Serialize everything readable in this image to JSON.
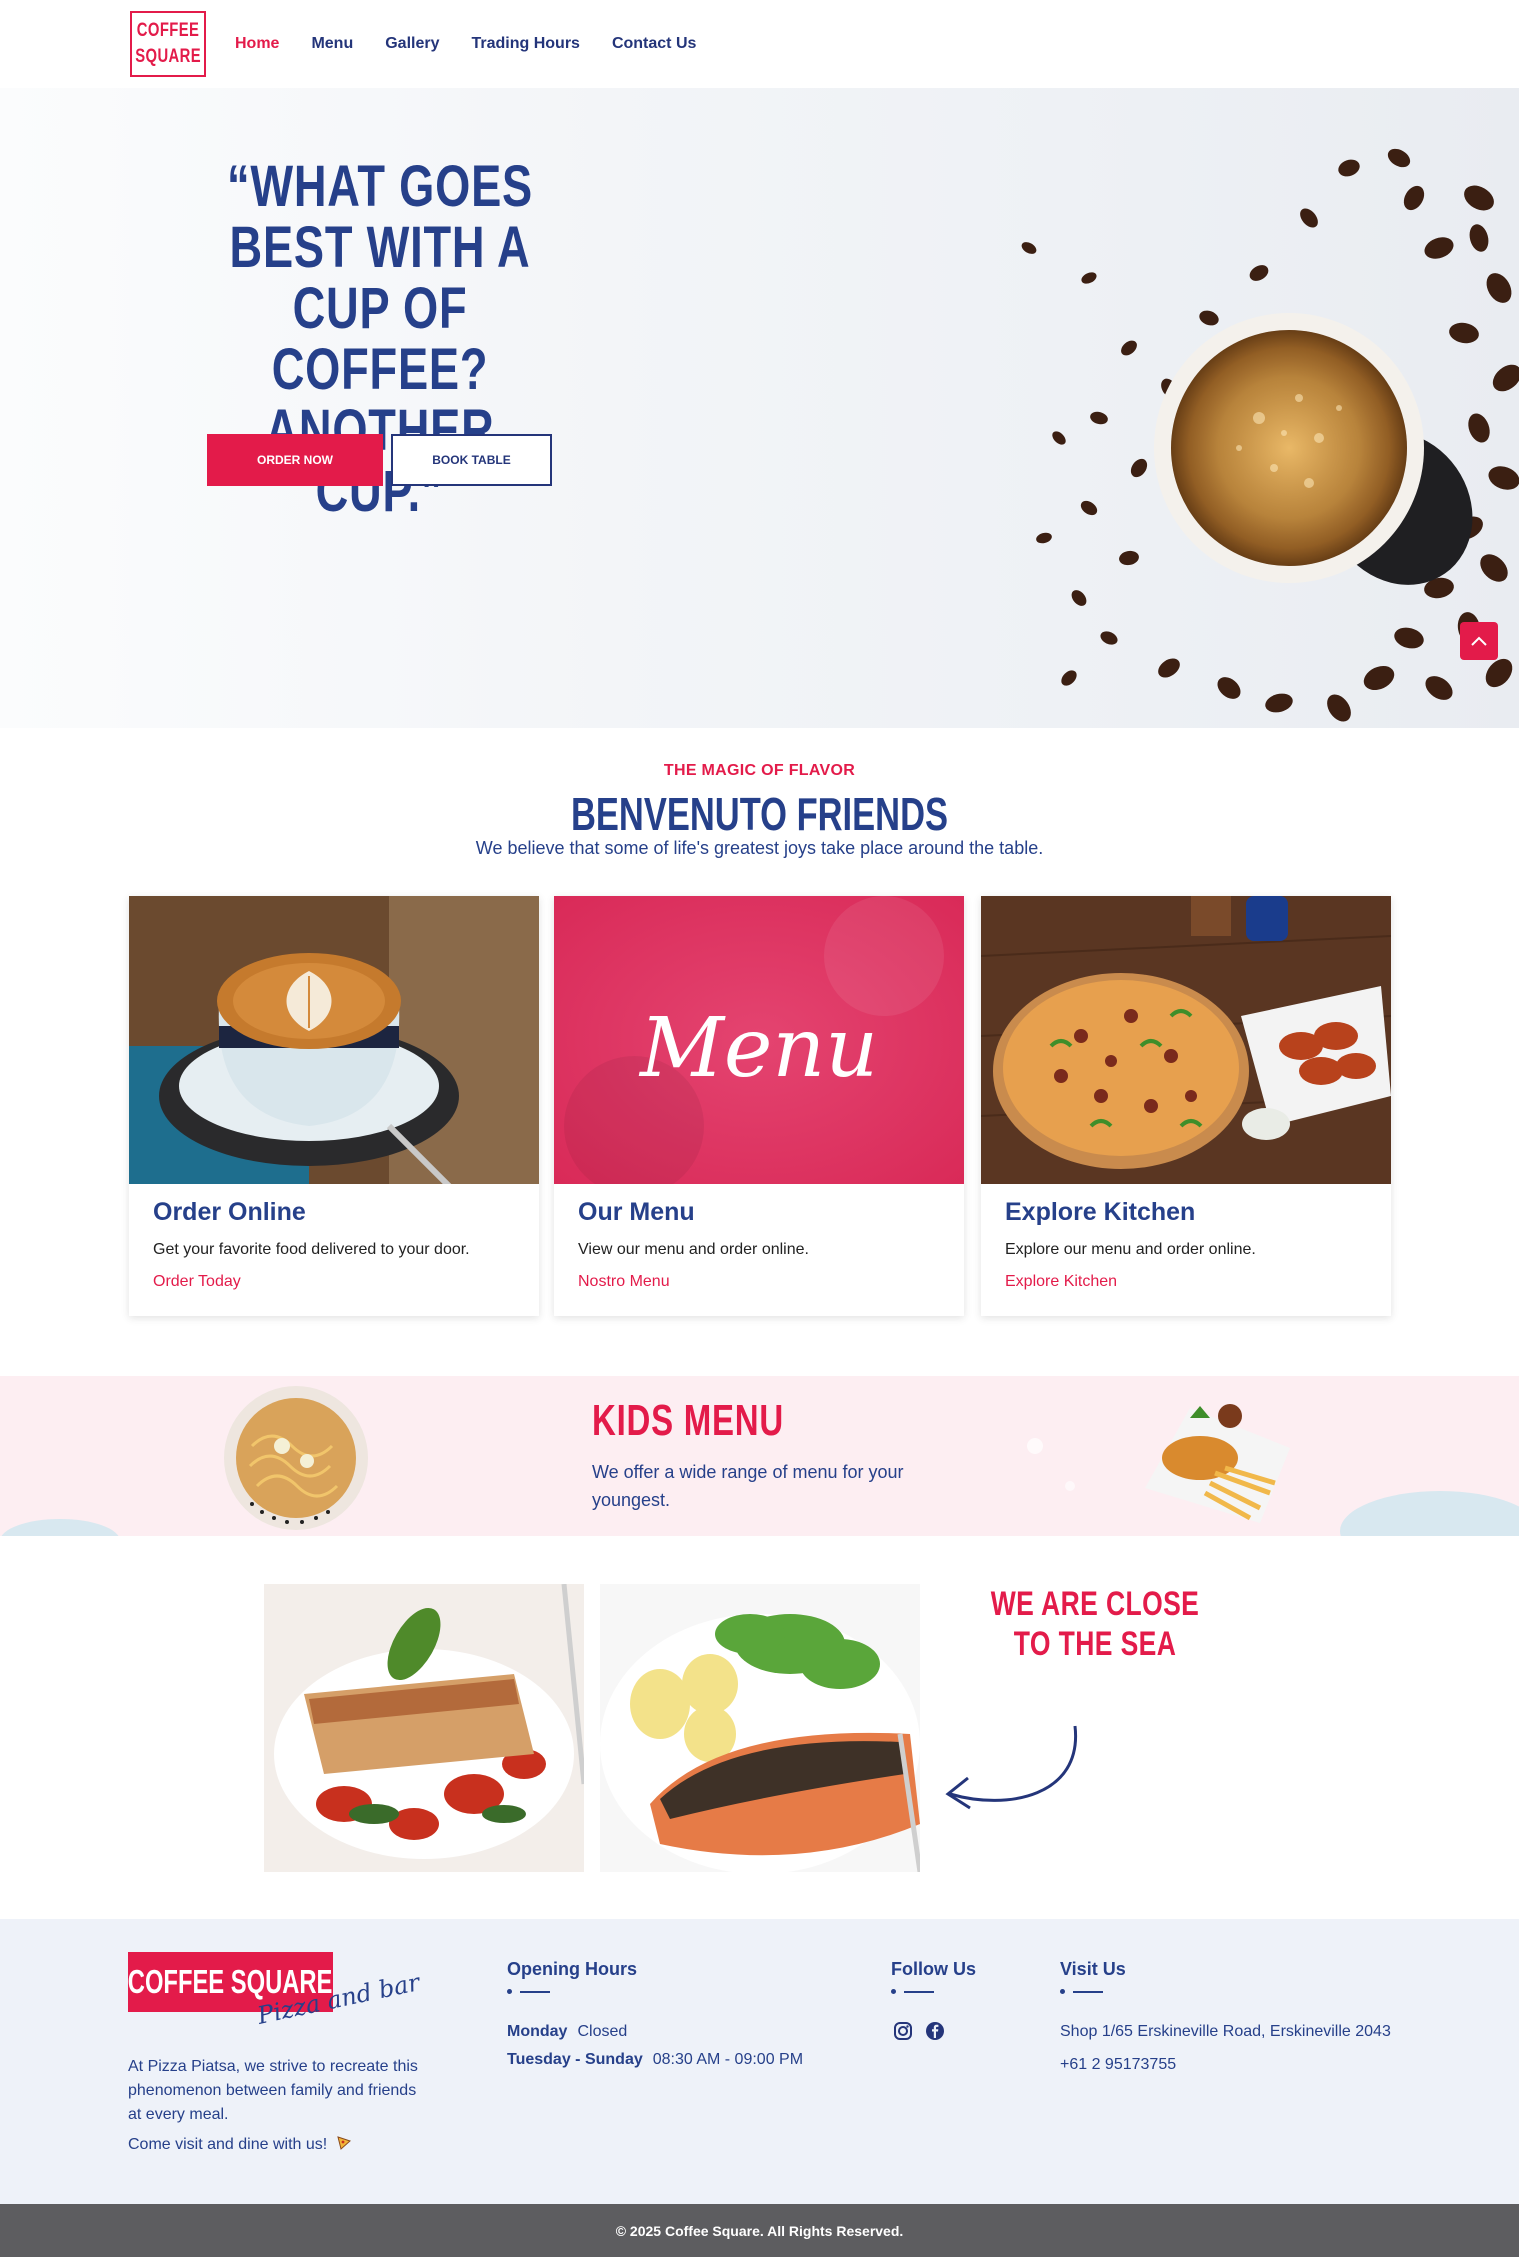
{
  "brand": {
    "logo_line1": "COFFEE",
    "logo_line2": "SQUARE",
    "footer_logo": "COFFEE SQUARE",
    "footer_tagline": "Pizza and bar"
  },
  "nav": {
    "items": [
      "Home",
      "Menu",
      "Gallery",
      "Trading Hours",
      "Contact Us"
    ],
    "active": "Home"
  },
  "hero": {
    "quote": "“WHAT GOES BEST WITH A CUP OF COFFEE? ANOTHER CUP.”",
    "order_label": "ORDER NOW",
    "book_label": "BOOK TABLE"
  },
  "intro": {
    "eyebrow": "THE MAGIC OF FLAVOR",
    "title": "BENVENUTO FRIENDS",
    "subtitle": "We believe that some of life's greatest joys take place around the table."
  },
  "cards": [
    {
      "title": "Order Online",
      "text": "Get your favorite food delivered to your door.",
      "link": "Order Today"
    },
    {
      "title": "Our Menu",
      "text": "View our menu and order online.",
      "link": "Nostro Menu",
      "image_text": "Menu"
    },
    {
      "title": "Explore Kitchen",
      "text": "Explore our menu and order online.",
      "link": "Explore Kitchen"
    }
  ],
  "kids": {
    "title": "KIDS MENU",
    "text": "We offer a wide range of menu for your youngest."
  },
  "sea": {
    "title": "WE ARE CLOSE TO THE SEA"
  },
  "footer": {
    "about": "At Pizza Piatsa, we strive to recreate this phenomenon between family and friends at every meal.",
    "visit_text": "Come visit and dine with us!",
    "hours_heading": "Opening Hours",
    "hours": [
      {
        "day": "Monday",
        "time": "Closed"
      },
      {
        "day": "Tuesday - Sunday",
        "time": "08:30 AM - 09:00 PM"
      }
    ],
    "follow_heading": "Follow Us",
    "social_icons": [
      "instagram-icon",
      "facebook-icon"
    ],
    "visit_heading": "Visit Us",
    "address": "Shop 1/65 Erskineville Road, Erskineville 2043",
    "phone": "+61 2 95173755"
  },
  "copyright": "© 2025 Coffee Square. All Rights Reserved.",
  "colors": {
    "accent": "#e31b4a",
    "navy": "#26408a",
    "footer_bg": "#eef2f9",
    "kids_bg": "#fdeef2"
  }
}
